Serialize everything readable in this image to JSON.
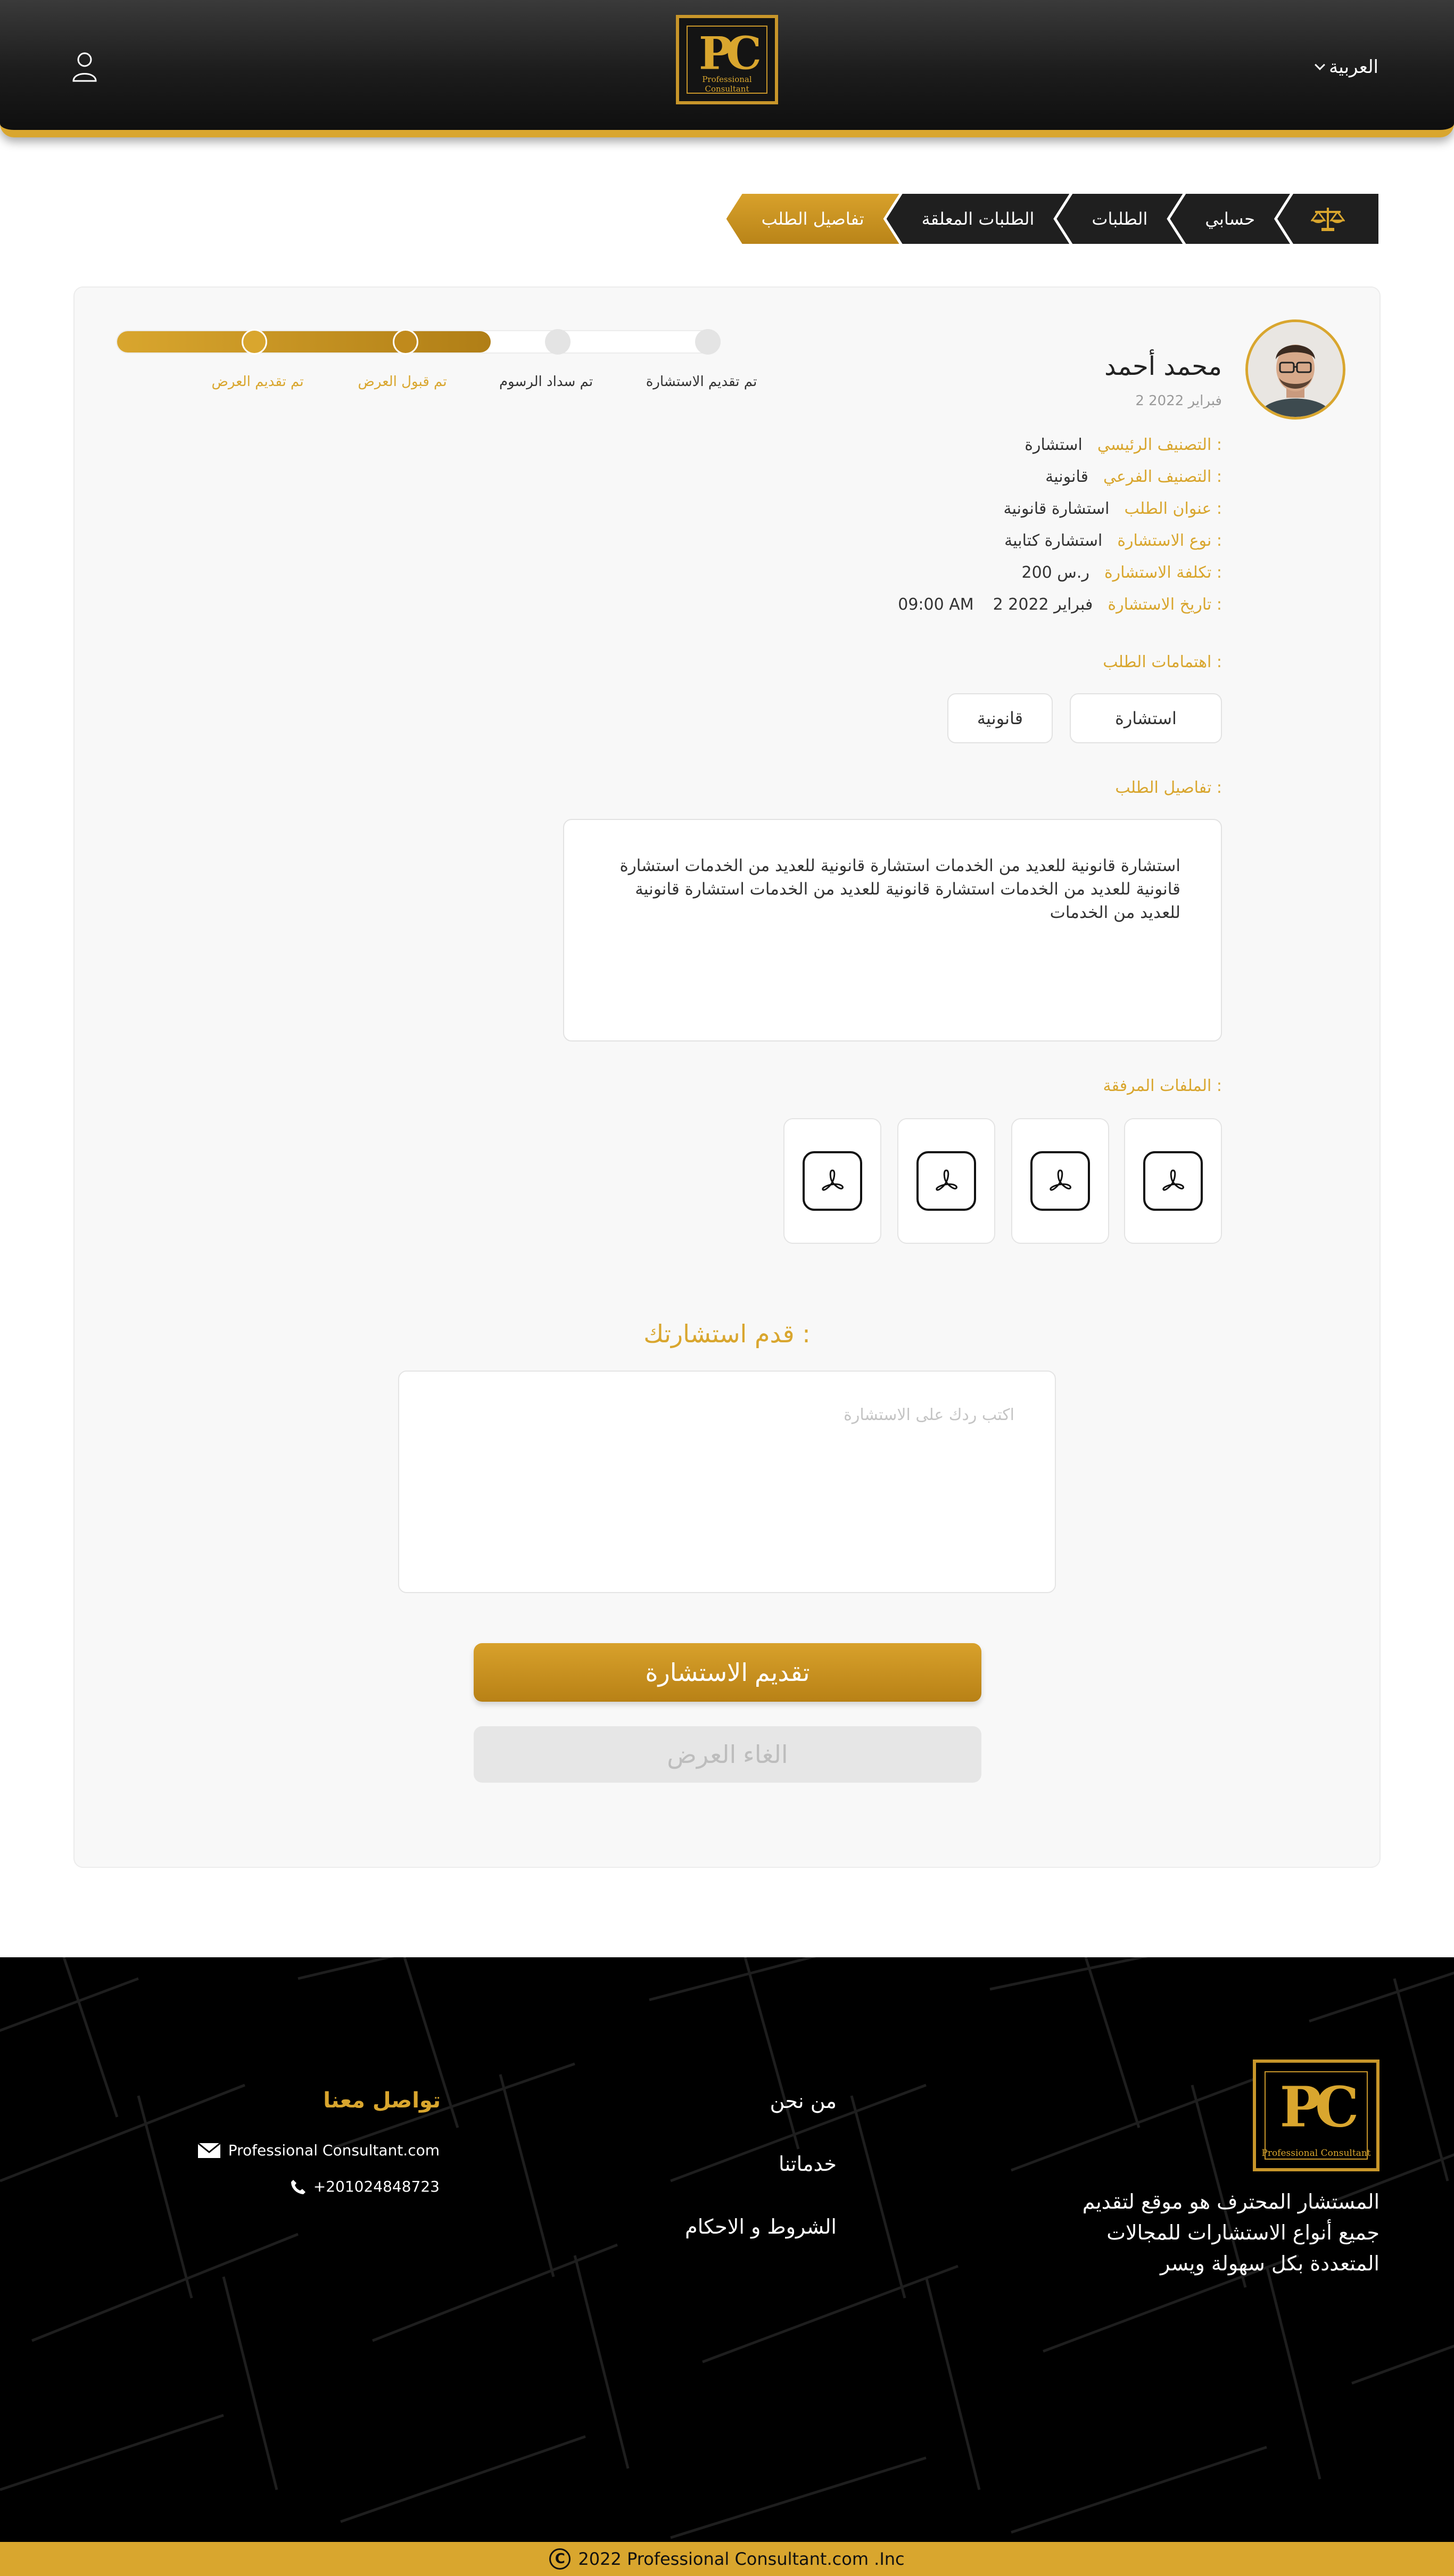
{
  "header": {
    "language": "العربية",
    "logo_mark": "PC",
    "logo_sub": "Professional Consultant"
  },
  "breadcrumb": [
    "حسابي",
    "الطلبات",
    "الطلبات المعلقة",
    "تفاصيل الطلب"
  ],
  "progress": {
    "steps": [
      "تم تقديم الاستشارة",
      "تم سداد الرسوم",
      "تم قبول العرض",
      "تم تقديم العرض"
    ],
    "completed_fraction": 0.62
  },
  "request": {
    "name": "محمد أحمد",
    "date": "2 فبراير 2022",
    "fields": [
      {
        "label": "التصنيف الرئيسي :",
        "value": "استشارة"
      },
      {
        "label": "التصنيف الفرعي :",
        "value": "قانونية"
      },
      {
        "label": "عنوان الطلب :",
        "value": "استشارة قانونية"
      },
      {
        "label": "نوع الاستشارة :",
        "value": "استشارة كتابية"
      },
      {
        "label": "تكلفة الاستشارة :",
        "value": "200 ر.س"
      },
      {
        "label": "تاريخ الاستشارة :",
        "value": "2 فبراير 2022",
        "time": "09:00 AM"
      }
    ],
    "interests_label": "اهتمامات الطلب :",
    "interests": [
      "استشارة",
      "قانونية"
    ],
    "details_label": "تفاصيل الطلب :",
    "details_text": "استشارة قانونية للعديد من الخدمات استشارة قانونية للعديد من الخدمات  استشارة قانونية للعديد من الخدمات  استشارة قانونية للعديد من الخدمات  استشارة قانونية للعديد من الخدمات",
    "files_label": "الملفات المرفقة :"
  },
  "reply": {
    "title": "قدم استشارتك :",
    "placeholder": "اكتب ردك على الاستشارة",
    "submit": "تقديم الاستشارة",
    "cancel": "الغاء العرض"
  },
  "footer": {
    "about": "المستشار المحترف هو موقع لتقديم جميع أنواع الاستشارات للمجالات المتعددة بكل سهولة ويسر",
    "links": [
      "من نحن",
      "خدماتنا",
      "الشروط و الاحكام"
    ],
    "contact_title": "تواصل معنا",
    "email": "Professional Consultant.com",
    "phone": "+201024848723",
    "copyright": "2022  Professional Consultant.com  .Inc"
  },
  "colors": {
    "accent": "#d9a62e",
    "dark": "#1c1c1c"
  }
}
